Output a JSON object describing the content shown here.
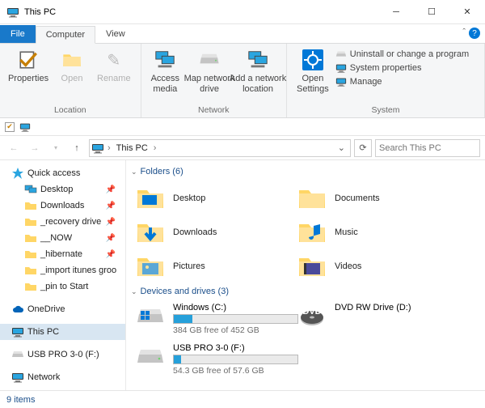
{
  "window": {
    "title": "This PC"
  },
  "tabs": {
    "file": "File",
    "computer": "Computer",
    "view": "View"
  },
  "ribbon": {
    "loc": {
      "label": "Location",
      "properties": "Properties",
      "open": "Open",
      "rename": "Rename"
    },
    "net": {
      "label": "Network",
      "access": "Access\nmedia",
      "map": "Map network\ndrive",
      "add": "Add a network\nlocation"
    },
    "sys": {
      "label": "System",
      "open": "Open\nSettings",
      "uninstall": "Uninstall or change a program",
      "props": "System properties",
      "manage": "Manage"
    }
  },
  "address": {
    "root": "This PC",
    "search_placeholder": "Search This PC"
  },
  "tree": {
    "quick": "Quick access",
    "items": [
      "Desktop",
      "Downloads",
      "_recovery drive",
      "__NOW",
      "_hibernate",
      "_import itunes groo",
      "_pin to Start"
    ],
    "onedrive": "OneDrive",
    "thispc": "This PC",
    "usb": "USB PRO 3-0 (F:)",
    "network": "Network"
  },
  "content": {
    "folders_header": "Folders (6)",
    "folders": [
      "Desktop",
      "Documents",
      "Downloads",
      "Music",
      "Pictures",
      "Videos"
    ],
    "drives_header": "Devices and drives (3)",
    "drives": [
      {
        "name": "Windows (C:)",
        "free": "384 GB free of 452 GB",
        "pct": 15
      },
      {
        "name": "DVD RW Drive (D:)",
        "free": "",
        "pct": -1
      },
      {
        "name": "USB PRO 3-0 (F:)",
        "free": "54.3 GB free of 57.6 GB",
        "pct": 6
      }
    ]
  },
  "status": "9 items"
}
